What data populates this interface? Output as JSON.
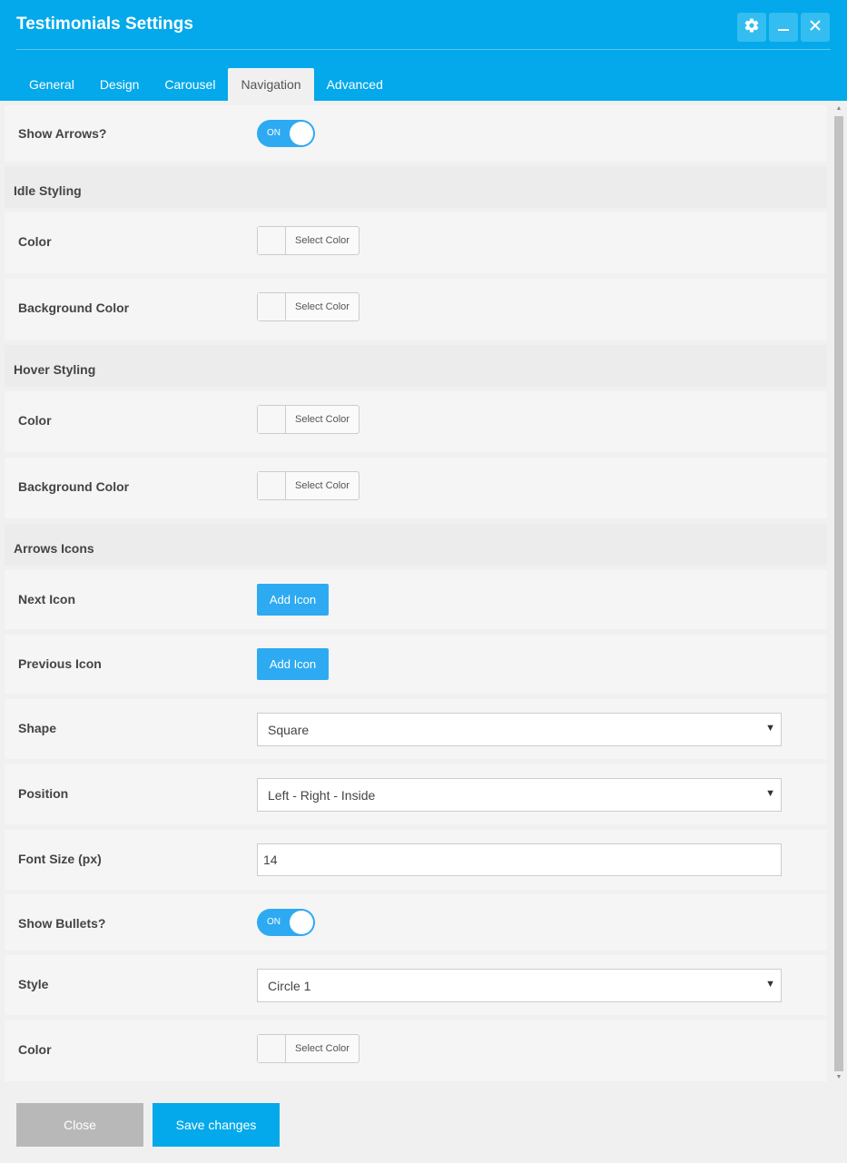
{
  "window": {
    "title": "Testimonials Settings"
  },
  "tabs": [
    {
      "label": "General"
    },
    {
      "label": "Design"
    },
    {
      "label": "Carousel"
    },
    {
      "label": "Navigation"
    },
    {
      "label": "Advanced"
    }
  ],
  "active_tab": "Navigation",
  "rows": {
    "show_arrows": {
      "label": "Show Arrows?",
      "toggle": "ON"
    },
    "idle_styling": {
      "label": "Idle Styling"
    },
    "idle_color": {
      "label": "Color",
      "button": "Select Color"
    },
    "idle_bg_color": {
      "label": "Background Color",
      "button": "Select Color"
    },
    "hover_styling": {
      "label": "Hover Styling"
    },
    "hover_color": {
      "label": "Color",
      "button": "Select Color"
    },
    "hover_bg_color": {
      "label": "Background Color",
      "button": "Select Color"
    },
    "arrows_icons": {
      "label": "Arrows Icons"
    },
    "next_icon": {
      "label": "Next Icon",
      "button": "Add Icon"
    },
    "previous_icon": {
      "label": "Previous Icon",
      "button": "Add Icon"
    },
    "shape": {
      "label": "Shape",
      "value": "Square"
    },
    "position": {
      "label": "Position",
      "value": "Left - Right - Inside"
    },
    "font_size": {
      "label": "Font Size (px)",
      "value": "14"
    },
    "show_bullets": {
      "label": "Show Bullets?",
      "toggle": "ON"
    },
    "style": {
      "label": "Style",
      "value": "Circle 1"
    },
    "bullet_color": {
      "label": "Color",
      "button": "Select Color"
    }
  },
  "footer": {
    "close_label": "Close",
    "save_label": "Save changes"
  },
  "colors": {
    "header": "#03a9ea",
    "accent": "#2eaaf2",
    "close_button": "#b8b8b8",
    "save_button": "#03a9ea"
  }
}
